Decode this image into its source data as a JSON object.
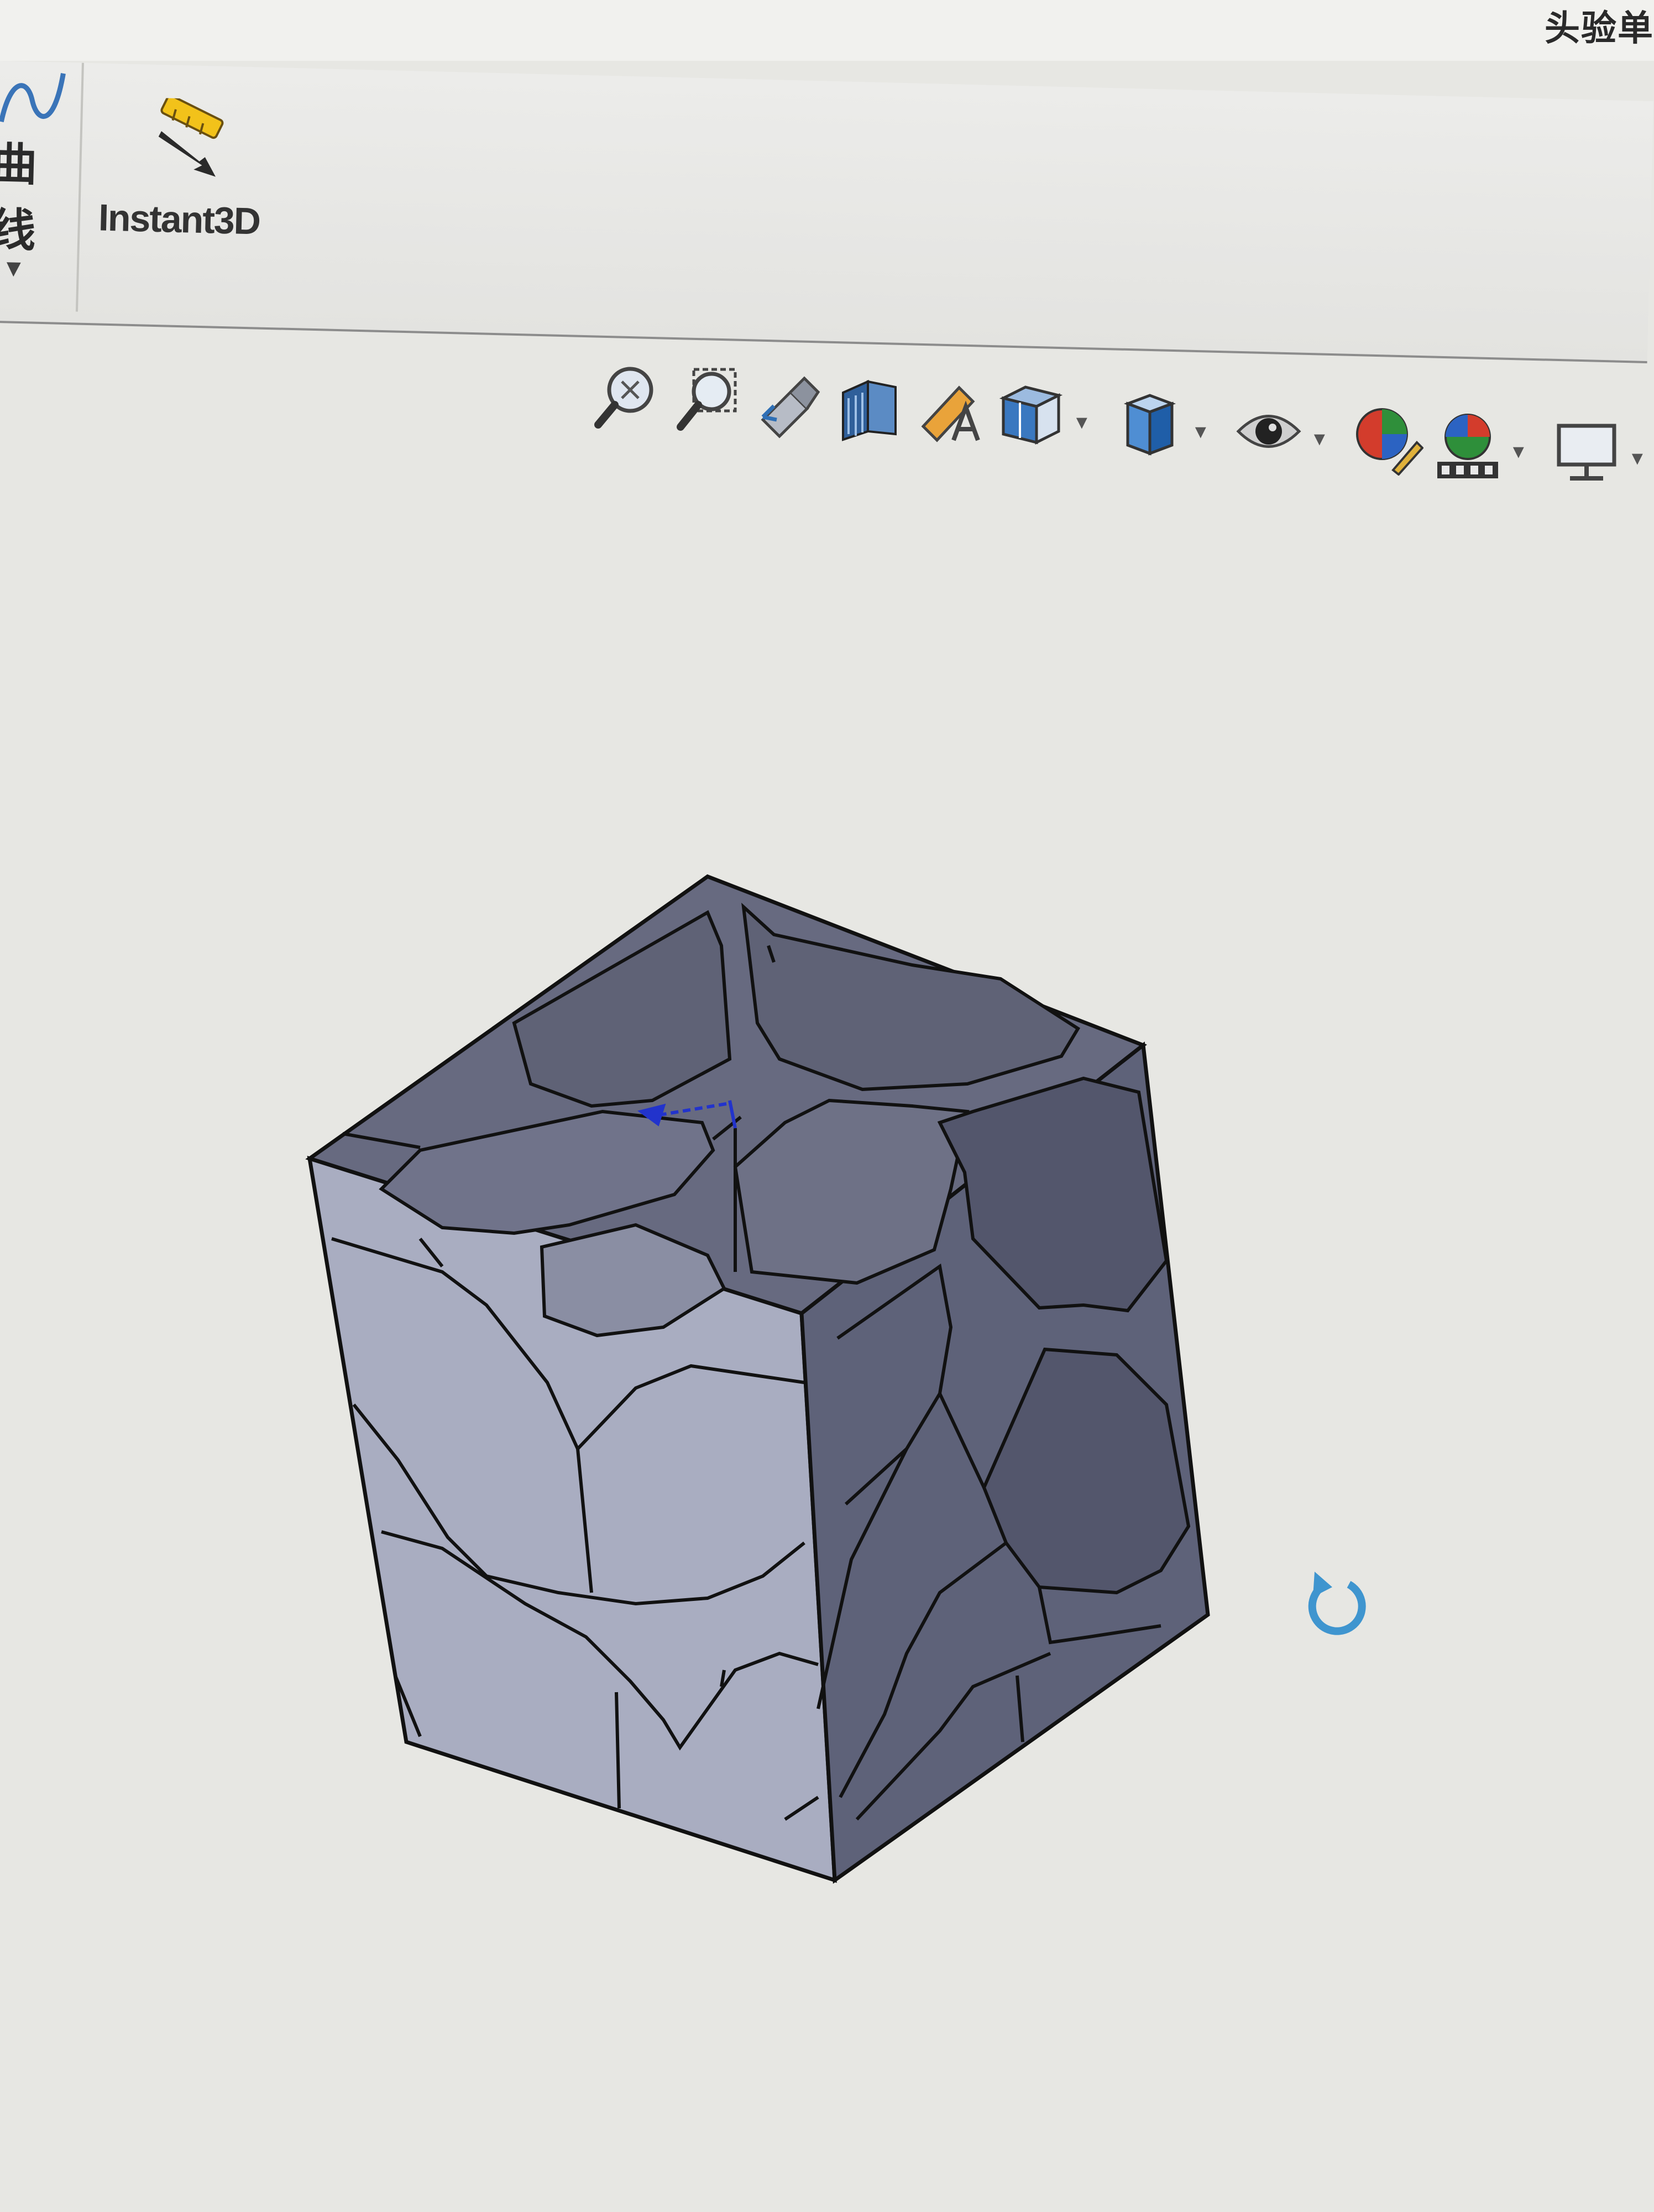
{
  "window": {
    "title": "头验单"
  },
  "ribbon": {
    "curves_label": "曲线",
    "instant3d_label": "Instant3D"
  },
  "view_toolbar": {
    "buttons": [
      "zoom-to-fit-icon",
      "zoom-to-area-icon",
      "previous-view-icon",
      "section-view-icon",
      "dynamic-annotation-icon",
      "view-orientation-icon",
      "display-style-icon",
      "hide-show-items-icon",
      "edit-appearance-icon",
      "apply-scene-icon",
      "view-settings-icon"
    ]
  },
  "graphics": {
    "model": "voronoi-grain-cube",
    "colors": {
      "top_face": "#676a80",
      "front_face": "#a9adc1",
      "right_face": "#5e6279",
      "edge_line": "#111111",
      "triad_arrow": "#2233cc",
      "rotate_indicator": "#3f95cf"
    }
  }
}
